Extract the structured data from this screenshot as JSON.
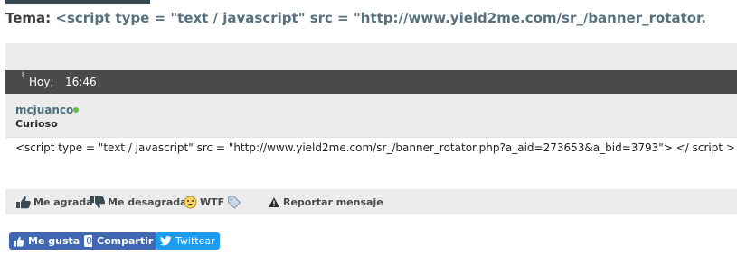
{
  "thread": {
    "title_label": "Tema:",
    "title_text": "<script type = \"text / javascript\" src = \"http://www.yield2me.com/sr_/banner_rotator."
  },
  "post": {
    "day": "Hoy,",
    "time": "16:46",
    "username": "mcjuanco",
    "online_status_color": "#5cbf4a",
    "rank": "Curioso",
    "body": "<script type = \"text / javascript\" src = \"http://www.yield2me.com/sr_/banner_rotator.php?a_aid=273653&a_bid=3793\"> </ script >"
  },
  "actions": {
    "like": "Me agrada",
    "dislike": "Me desagrada",
    "wtf": "WTF",
    "report": "Reportar mensaje"
  },
  "social": {
    "like": "Me gusta",
    "like_count": "0",
    "share": "Compartir",
    "tweet": "Twittear"
  },
  "colors": {
    "facebook": "#4267b2",
    "twitter": "#1d9bf0",
    "username": "#4d6f80"
  }
}
